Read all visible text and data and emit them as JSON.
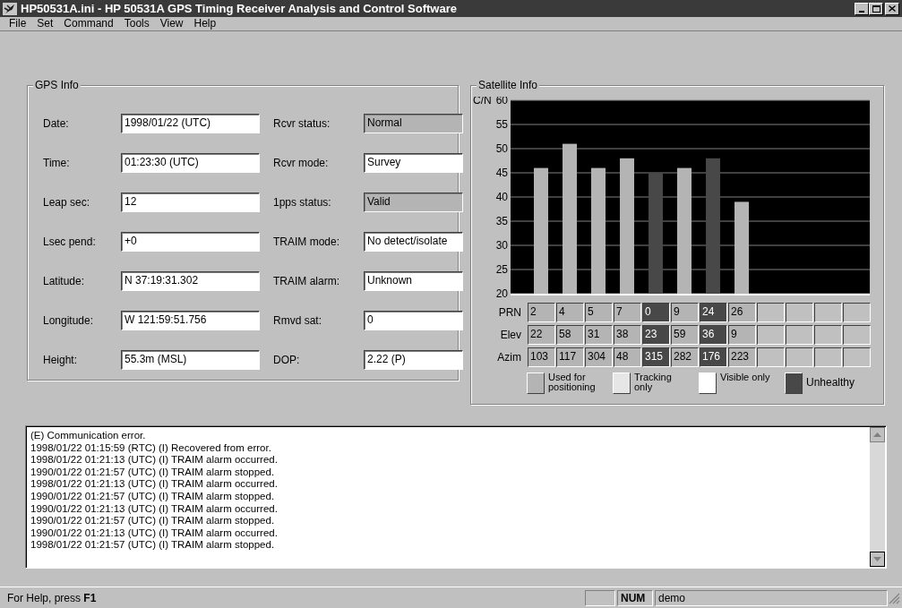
{
  "window": {
    "title": "HP50531A.ini - HP 50531A GPS Timing Receiver Analysis and Control Software"
  },
  "menu": [
    "File",
    "Set",
    "Command",
    "Tools",
    "View",
    "Help"
  ],
  "gps_info": {
    "title": "GPS Info",
    "left_fields": [
      {
        "label": "Date:",
        "value": "1998/01/22 (UTC)",
        "disabled": false
      },
      {
        "label": "Time:",
        "value": "01:23:30 (UTC)",
        "disabled": false
      },
      {
        "label": "Leap sec:",
        "value": "12",
        "disabled": false
      },
      {
        "label": "Lsec pend:",
        "value": "+0",
        "disabled": false
      },
      {
        "label": "Latitude:",
        "value": "N 37:19:31.302",
        "disabled": false
      },
      {
        "label": "Longitude:",
        "value": "W 121:59:51.756",
        "disabled": false
      },
      {
        "label": "Height:",
        "value": "55.3m (MSL)",
        "disabled": false
      }
    ],
    "right_fields": [
      {
        "label": "Rcvr status:",
        "value": "Normal",
        "disabled": true
      },
      {
        "label": "Rcvr mode:",
        "value": "Survey",
        "disabled": false
      },
      {
        "label": "1pps status:",
        "value": "Valid",
        "disabled": true
      },
      {
        "label": "TRAIM mode:",
        "value": "No detect/isolate",
        "disabled": false
      },
      {
        "label": "TRAIM alarm:",
        "value": "Unknown",
        "disabled": false
      },
      {
        "label": "Rmvd sat:",
        "value": "0",
        "disabled": false
      },
      {
        "label": "DOP:",
        "value": "2.22 (P)",
        "disabled": false
      }
    ]
  },
  "satellite_info": {
    "title": "Satellite Info",
    "chart_data": {
      "type": "bar",
      "ylabel": "C/N",
      "ylim": [
        20,
        60
      ],
      "yticks": [
        20,
        25,
        30,
        35,
        40,
        45,
        50,
        55,
        60
      ],
      "grid": true,
      "stacked": true,
      "series": [
        {
          "color": "#b4b4b4",
          "values": [
            46,
            51,
            46,
            48,
            null,
            46,
            null,
            39
          ]
        },
        {
          "color": "#484848",
          "values": [
            null,
            null,
            null,
            null,
            45,
            null,
            48,
            null
          ]
        }
      ]
    },
    "row_labels": [
      "PRN",
      "Elev",
      "Azim"
    ],
    "satellites": [
      {
        "prn": "2",
        "elev": "22",
        "azim": "103",
        "kind": "used"
      },
      {
        "prn": "4",
        "elev": "58",
        "azim": "117",
        "kind": "used"
      },
      {
        "prn": "5",
        "elev": "31",
        "azim": "304",
        "kind": "used"
      },
      {
        "prn": "7",
        "elev": "38",
        "azim": "48",
        "kind": "used"
      },
      {
        "prn": "0",
        "elev": "23",
        "azim": "315",
        "kind": "unhealthy"
      },
      {
        "prn": "9",
        "elev": "59",
        "azim": "282",
        "kind": "used"
      },
      {
        "prn": "24",
        "elev": "36",
        "azim": "176",
        "kind": "unhealthy"
      },
      {
        "prn": "26",
        "elev": "9",
        "azim": "223",
        "kind": "used"
      },
      {
        "kind": "empty"
      },
      {
        "kind": "empty"
      },
      {
        "kind": "empty"
      },
      {
        "kind": "empty"
      }
    ],
    "legend": [
      {
        "kind": "used",
        "label": "Used for positioning",
        "color": "#b4b4b4"
      },
      {
        "kind": "tracking",
        "label": "Tracking only",
        "color": "#e6e6e6"
      },
      {
        "kind": "visible",
        "label": "Visible only",
        "color": "#ffffff"
      },
      {
        "kind": "unhealthy",
        "label": "Unhealthy",
        "color": "#484848"
      }
    ]
  },
  "log": [
    "(E) Communication error.",
    "1998/01/22 01:15:59 (RTC) (I) Recovered from error.",
    "1998/01/22 01:21:13 (UTC) (I) TRAIM alarm occurred.",
    "1990/01/22 01:21:57 (UTC) (I) TRAIM alarm stopped.",
    "1998/01/22 01:21:13 (UTC) (I) TRAIM alarm occurred.",
    "1990/01/22 01:21:57 (UTC) (I) TRAIM alarm stopped.",
    "1990/01/22 01:21:13 (UTC) (I) TRAIM alarm occurred.",
    "1990/01/22 01:21:57 (UTC) (I) TRAIM alarm stopped.",
    "1990/01/22 01:21:13 (UTC) (I) TRAIM alarm occurred.",
    "1998/01/22 01:21:57 (UTC) (I) TRAIM alarm stopped."
  ],
  "status_bar": {
    "help": "For Help, press **F1**",
    "panes": [
      "NUM",
      "demo"
    ]
  }
}
